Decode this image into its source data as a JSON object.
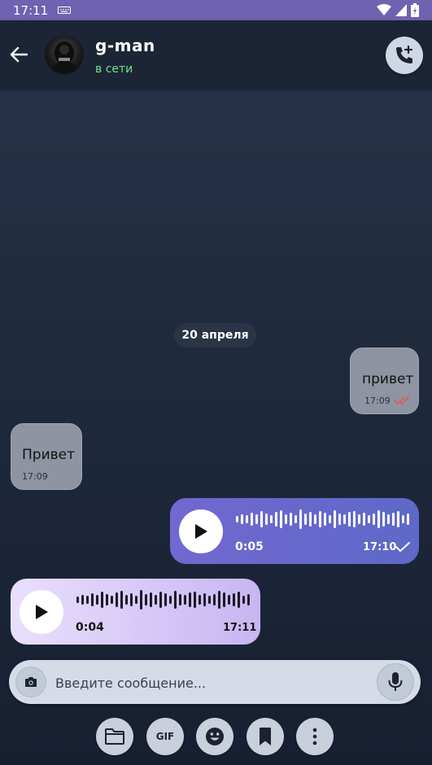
{
  "status_bar": {
    "time": "17:11"
  },
  "header": {
    "back_icon": "arrow-left-icon",
    "contact_name": "g-man",
    "contact_status": "в сети",
    "call_icon": "add-call-icon"
  },
  "chat": {
    "date_separator": "20 апреля",
    "messages": [
      {
        "direction": "outgoing",
        "type": "text",
        "text": "привет",
        "time": "17:09",
        "status": "read"
      },
      {
        "direction": "incoming",
        "type": "text",
        "text": "Привет",
        "time": "17:09"
      },
      {
        "direction": "outgoing",
        "type": "voice",
        "duration": "0:05",
        "time": "17:10",
        "status": "sent"
      },
      {
        "direction": "incoming",
        "type": "voice",
        "duration": "0:04",
        "time": "17:11"
      }
    ]
  },
  "composer": {
    "placeholder": "Введите сообщение...",
    "camera_icon": "camera-icon",
    "mic_icon": "microphone-icon"
  },
  "toolbar": {
    "buttons": [
      {
        "name": "folder-icon"
      },
      {
        "name": "gif-button",
        "label": "GIF"
      },
      {
        "name": "emoji-icon"
      },
      {
        "name": "bookmark-icon"
      },
      {
        "name": "more-vertical-icon"
      }
    ]
  },
  "colors": {
    "status_bar": "#6f62b0",
    "online": "#6fe38c",
    "outgoing_voice": "#6a69cd",
    "incoming_voice": "#d9ccf7",
    "read_ticks": "#e05a5a"
  }
}
